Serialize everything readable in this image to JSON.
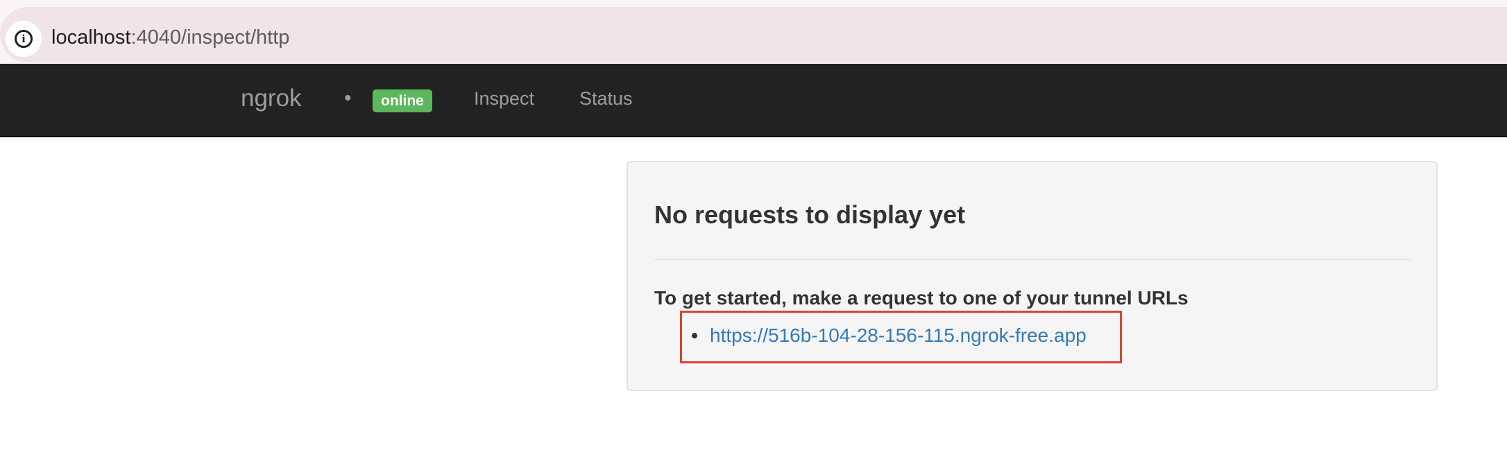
{
  "browser": {
    "url_host": "localhost",
    "url_rest": ":4040/inspect/http",
    "info_icon": "info-icon"
  },
  "navbar": {
    "brand": "ngrok",
    "separator": "•",
    "status_badge": "online",
    "links": [
      "Inspect",
      "Status"
    ]
  },
  "panel": {
    "title": "No requests to display yet",
    "intro": "To get started, make a request to one of your tunnel URLs",
    "tunnel_urls": [
      "https://516b-104-28-156-115.ngrok-free.app"
    ]
  },
  "colors": {
    "navbar_bg": "#222222",
    "badge_green": "#5cb85c",
    "link_blue": "#337ab7",
    "highlight_red": "#d9442e",
    "panel_bg": "#f5f5f5"
  }
}
